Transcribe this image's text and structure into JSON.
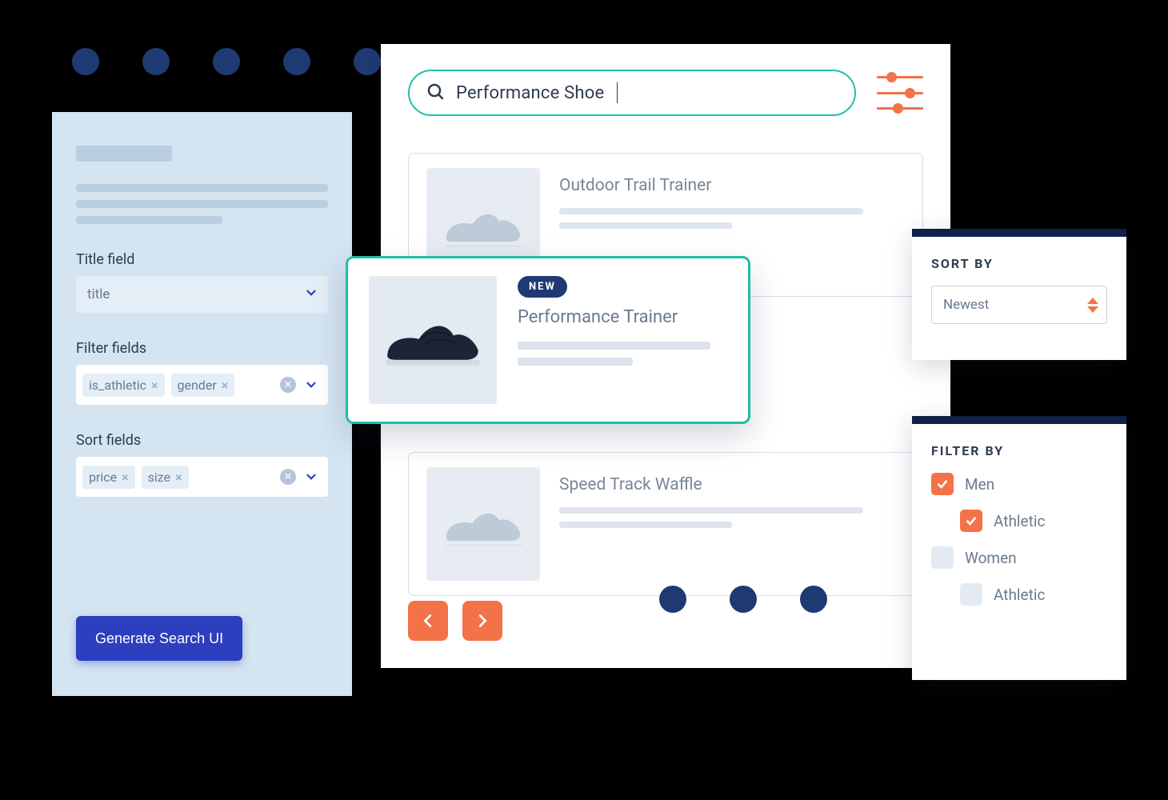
{
  "config": {
    "title_field": {
      "label": "Title field",
      "value": "title"
    },
    "filter_fields": {
      "label": "Filter fields",
      "tags": [
        {
          "name": "is_athletic"
        },
        {
          "name": "gender"
        }
      ]
    },
    "sort_fields": {
      "label": "Sort fields",
      "tags": [
        {
          "name": "price"
        },
        {
          "name": "size"
        }
      ]
    },
    "generate_label": "Generate Search UI"
  },
  "search": {
    "query": "Performance Shoe"
  },
  "featured": {
    "badge": "NEW",
    "title": "Performance Trainer"
  },
  "results": [
    {
      "title": "Outdoor Trail Trainer"
    },
    {
      "title": "Speed Track Waffle"
    }
  ],
  "sort_panel": {
    "title": "SORT BY",
    "value": "Newest"
  },
  "filter_panel": {
    "title": "FILTER BY",
    "items": [
      {
        "label": "Men",
        "checked": true,
        "indent": false
      },
      {
        "label": "Athletic",
        "checked": true,
        "indent": true
      },
      {
        "label": "Women",
        "checked": false,
        "indent": false
      },
      {
        "label": "Athletic",
        "checked": false,
        "indent": true
      }
    ]
  }
}
